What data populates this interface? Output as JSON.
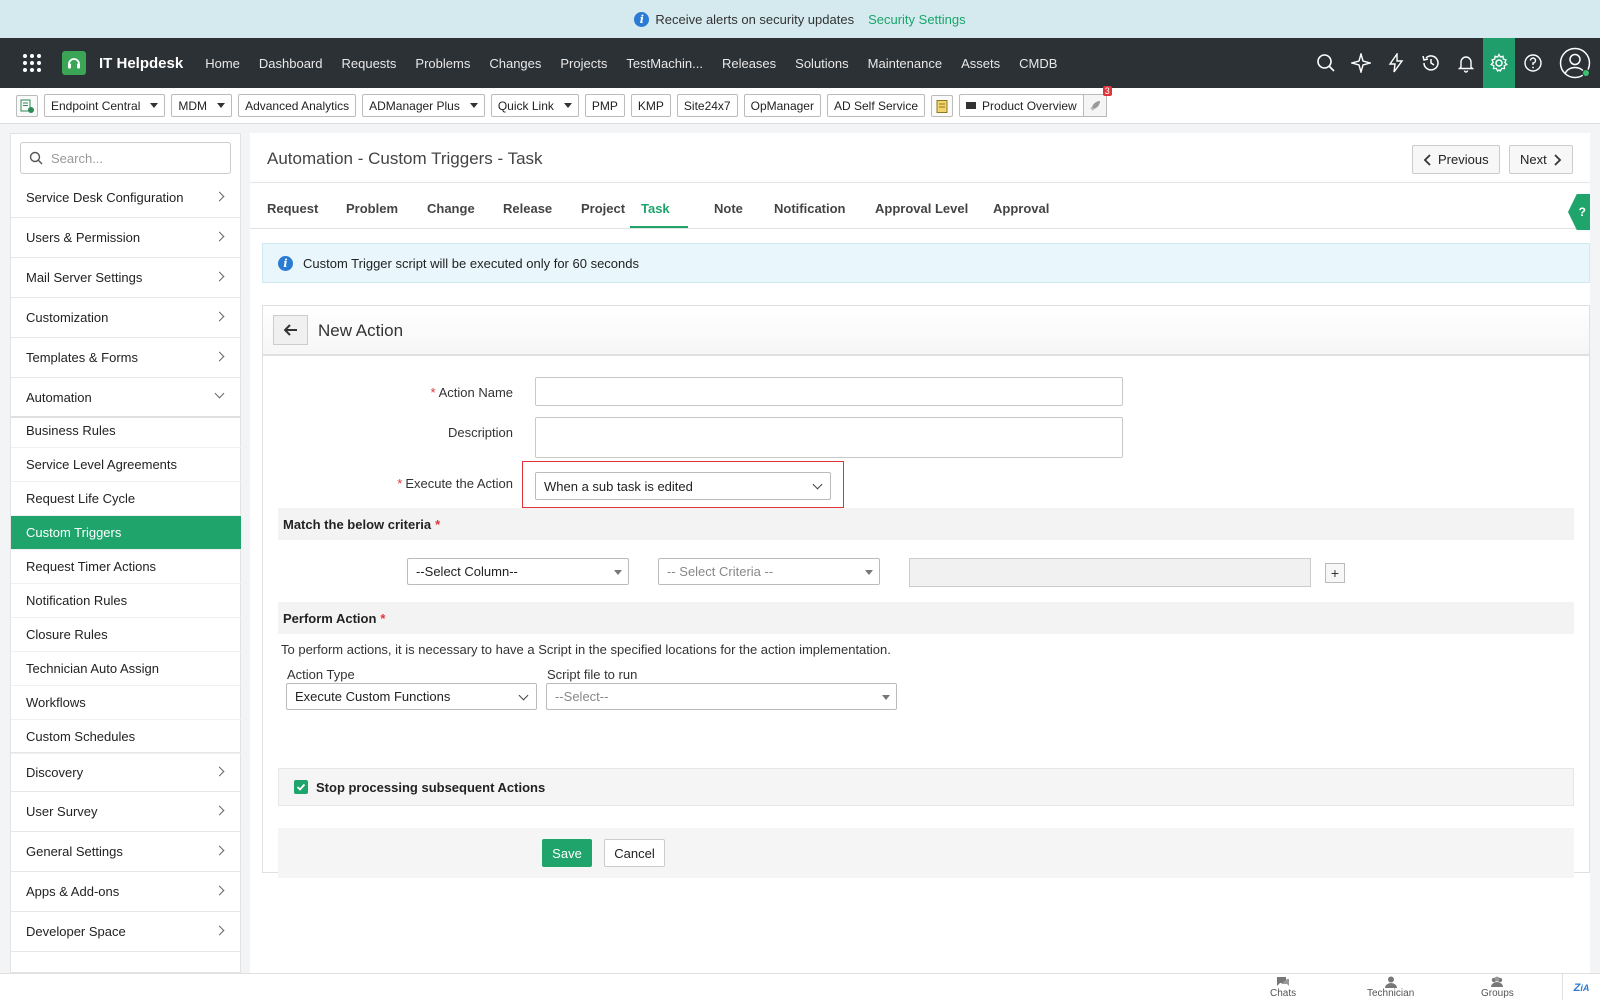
{
  "banner": {
    "message": "Receive alerts on security updates",
    "link": "Security Settings"
  },
  "app": {
    "title": "IT Helpdesk"
  },
  "nav": {
    "items": [
      "Home",
      "Dashboard",
      "Requests",
      "Problems",
      "Changes",
      "Projects",
      "TestMachin...",
      "Releases",
      "Solutions",
      "Maintenance",
      "Assets",
      "CMDB"
    ]
  },
  "nav_icons": [
    "search-icon",
    "ai-sparkle-icon",
    "lightning-icon",
    "history-icon",
    "bell-icon",
    "settings-gear-icon",
    "help-icon",
    "user-avatar-icon"
  ],
  "toolbar": {
    "endpoint": "Endpoint Central",
    "mdm": "MDM",
    "analytics": "Advanced Analytics",
    "admanager": "ADManager Plus",
    "quicklink": "Quick Link",
    "pmp": "PMP",
    "kmp": "KMP",
    "site24x7": "Site24x7",
    "opmanager": "OpManager",
    "adselfservice": "AD Self Service",
    "product_overview": "Product Overview",
    "rocket_badge": "3"
  },
  "sidebar": {
    "search_placeholder": "Search...",
    "top_items": [
      "Service Desk Configuration",
      "Users & Permission",
      "Mail Server Settings",
      "Customization",
      "Templates & Forms",
      "Automation"
    ],
    "automation_sub": [
      "Business Rules",
      "Service Level Agreements",
      "Request Life Cycle",
      "Custom Triggers",
      "Request Timer Actions",
      "Notification Rules",
      "Closure Rules",
      "Technician Auto Assign",
      "Workflows",
      "Custom Schedules"
    ],
    "bottom_items": [
      "Discovery",
      "User Survey",
      "General Settings",
      "Apps & Add-ons",
      "Developer Space"
    ]
  },
  "page": {
    "title": "Automation - Custom Triggers - Task",
    "prev": "Previous",
    "next": "Next",
    "tabs": [
      "Request",
      "Problem",
      "Change",
      "Release",
      "Project",
      "Task",
      "Note",
      "Notification",
      "Approval Level",
      "Approval"
    ],
    "active_tab": "Task",
    "info": "Custom Trigger script will be executed only for 60 seconds"
  },
  "form": {
    "title": "New Action",
    "action_name_label": "Action Name",
    "action_name_value": "",
    "description_label": "Description",
    "description_value": "",
    "execute_label": "Execute the Action",
    "execute_value": "When a sub task is edited",
    "criteria_title": "Match the below criteria",
    "select_column": "--Select Column--",
    "select_criteria": "-- Select Criteria --",
    "perform_title": "Perform Action",
    "perform_note": "To perform actions, it is necessary to have a Script in the specified locations for the action implementation.",
    "action_type_label": "Action Type",
    "action_type_value": "Execute Custom Functions",
    "script_label": "Script file to run",
    "script_value": "--Select--",
    "stop_label": "Stop processing subsequent Actions",
    "stop_checked": true,
    "save": "Save",
    "cancel": "Cancel"
  },
  "footer": {
    "chats": "Chats",
    "technician": "Technician",
    "groups": "Groups",
    "zia": "Zia"
  },
  "colors": {
    "accent": "#1fa46c",
    "header_bg": "#2c3135",
    "banner_bg": "#d5eaee",
    "highlight": "#e0343d"
  }
}
